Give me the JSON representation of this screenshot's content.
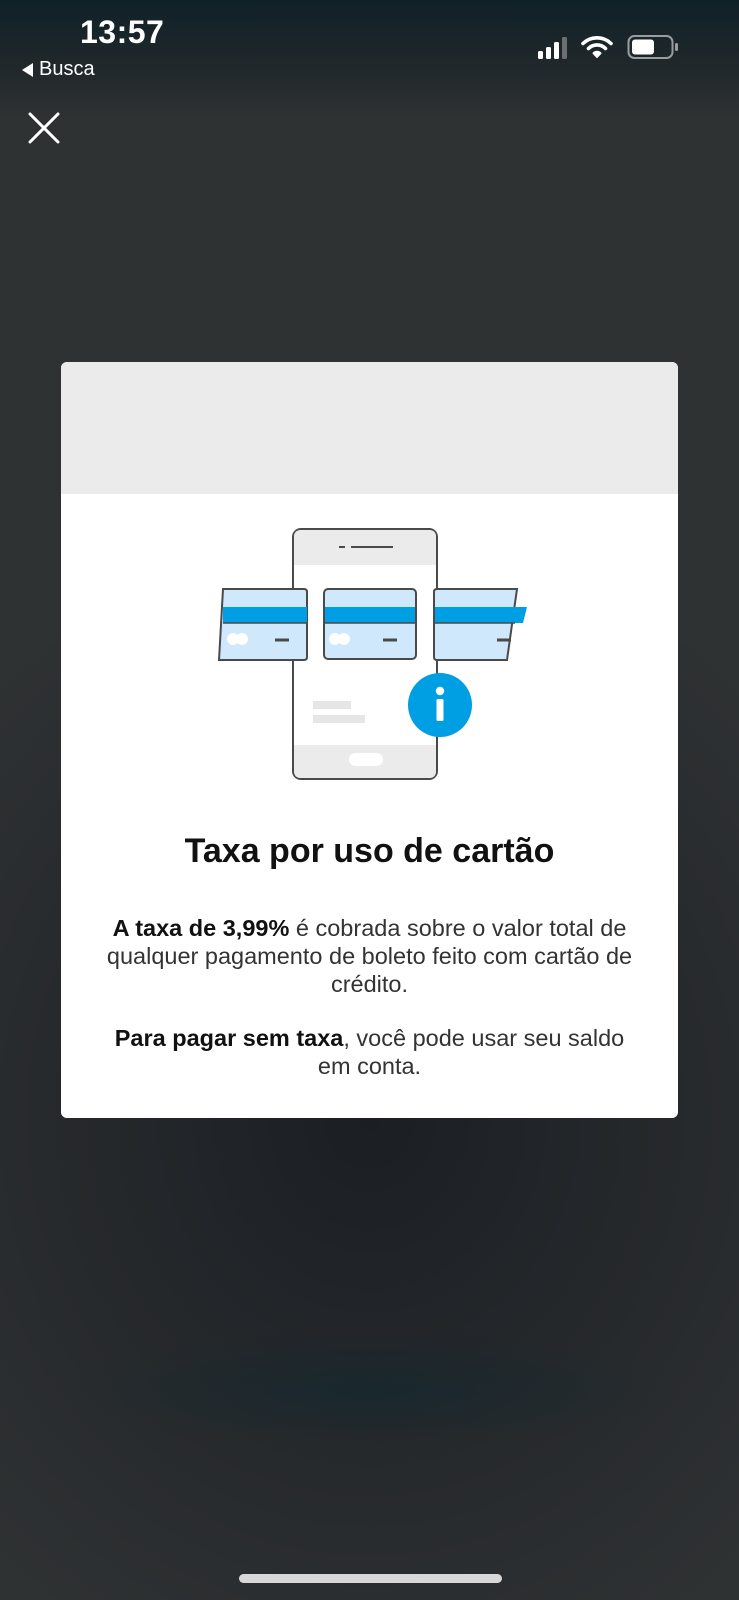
{
  "status_bar": {
    "time": "13:57",
    "back_label": "Busca"
  },
  "modal": {
    "title": "Taxa por uso de cartão",
    "paragraph1_bold": "A taxa de 3,99%",
    "paragraph1_rest": " é cobrada sobre o valor total de qualquer pagamento de boleto feito com cartão de crédito.",
    "paragraph2_bold": "Para pagar sem taxa",
    "paragraph2_rest": ", você pode usar seu saldo em conta."
  },
  "icons": {
    "close": "close-icon",
    "info": "info-icon",
    "signal": "cellular-signal-icon",
    "wifi": "wifi-icon",
    "battery": "battery-icon"
  },
  "colors": {
    "accent": "#009ee3",
    "card_fill": "#cfe8fb",
    "modal_header": "#ebebeb"
  }
}
